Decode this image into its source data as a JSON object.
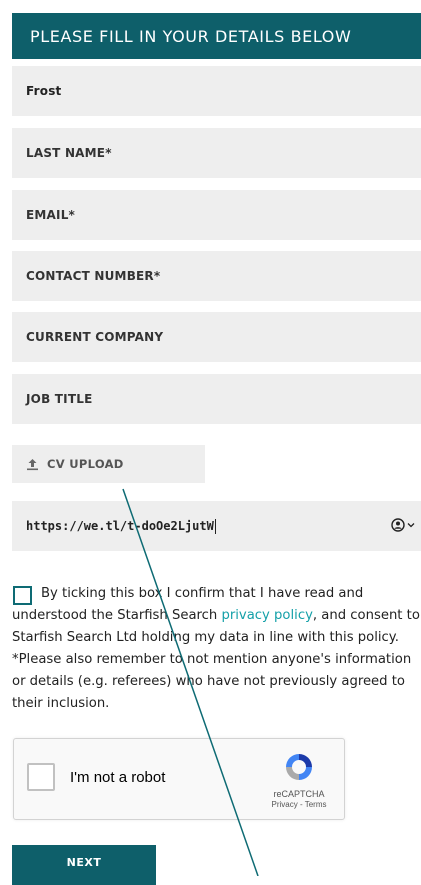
{
  "header": {
    "title": "PLEASE FILL IN YOUR DETAILS BELOW"
  },
  "form": {
    "first_name_value": "Frost",
    "last_name_placeholder": "LAST NAME*",
    "email_placeholder": "EMAIL*",
    "contact_placeholder": "CONTACT NUMBER*",
    "company_placeholder": "CURRENT COMPANY",
    "job_title_placeholder": "JOB TITLE",
    "cv_upload_label": "CV UPLOAD",
    "url_value": "https://we.tl/t-doOe2LjutW"
  },
  "consent": {
    "line1": "By ticking this box I confirm that I have read and",
    "line2_pre": "understood the Starfish Search ",
    "link_text": "privacy policy",
    "line2_post": ", and consent to",
    "line3": "Starfish Search Ltd holding my data in line with this policy.",
    "line4": "*Please also remember to not mention anyone's information",
    "line5": "or details (e.g. referees) who have not previously agreed to",
    "line6": "their inclusion."
  },
  "recaptcha": {
    "label": "I'm not a robot",
    "brand": "reCAPTCHA",
    "links": "Privacy - Terms"
  },
  "next_label": "NEXT",
  "colors": {
    "primary": "#0e5f6a",
    "link": "#14a0a8",
    "field_bg": "#eeeeee"
  },
  "icons": {
    "upload": "upload-icon",
    "autofill": "contact-card-icon"
  }
}
